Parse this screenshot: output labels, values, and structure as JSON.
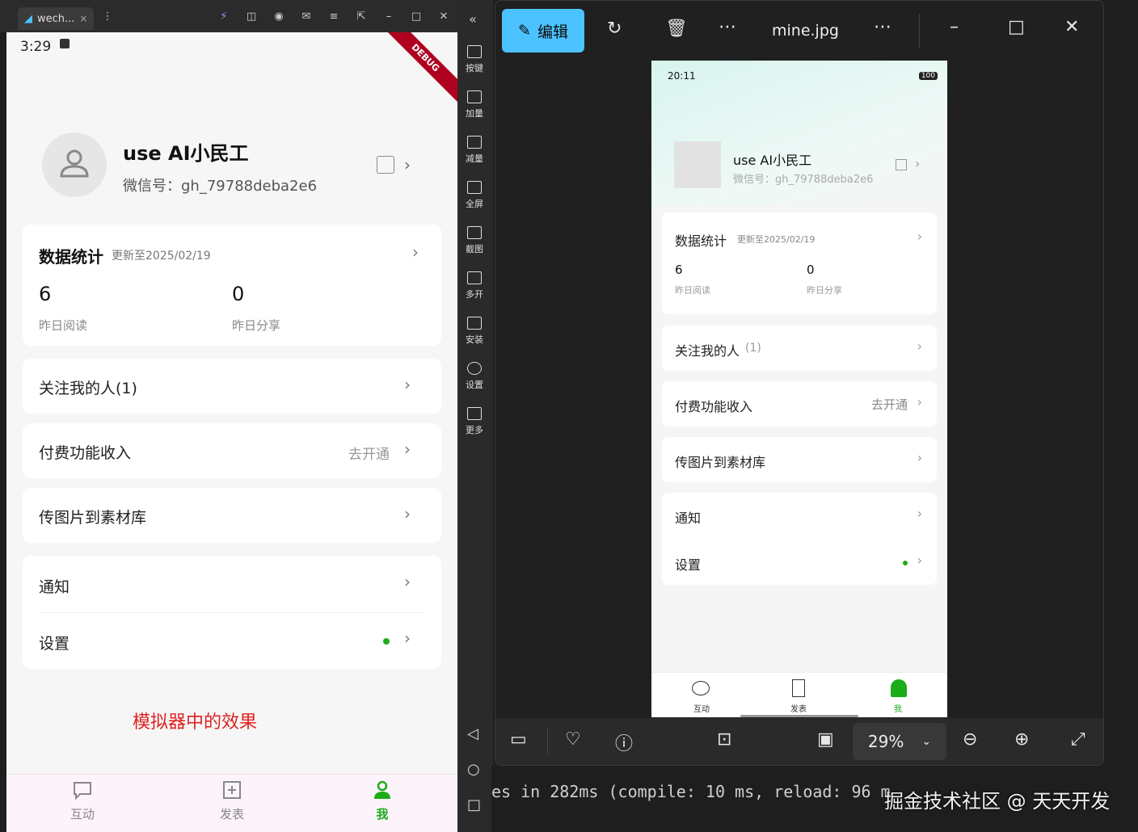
{
  "emulator": {
    "tab_label": "wech...",
    "tab_close": "×",
    "status_time": "3:29",
    "debug_ribbon": "DEBUG",
    "profile": {
      "nickname": "use AI小民工",
      "wechat_id": "微信号：gh_79788deba2e6"
    },
    "stats": {
      "title": "数据统计",
      "updated": "更新至2025/02/19",
      "read_value": "6",
      "read_label": "昨日阅读",
      "share_value": "0",
      "share_label": "昨日分享"
    },
    "rows": {
      "followers": "关注我的人(1)",
      "paid": "付费功能收入",
      "paid_action": "去开通",
      "upload": "传图片到素材库",
      "notify": "通知",
      "settings": "设置"
    },
    "caption": "模拟器中的效果",
    "tabs": {
      "interact": "互动",
      "publish": "发表",
      "me": "我"
    }
  },
  "side_toolbar": {
    "items": [
      "按键",
      "加量",
      "减量",
      "全屏",
      "截图",
      "多开",
      "安装",
      "设置",
      "更多"
    ]
  },
  "viewer": {
    "edit_label": "编辑",
    "filename": "mine.jpg",
    "zoom": "29%",
    "image": {
      "status_time": "20:11",
      "battery": "100",
      "nickname": "use AI小民工",
      "wechat_id": "微信号：gh_79788deba2e6",
      "stats_title": "数据统计",
      "stats_updated": "更新至2025/02/19",
      "read_value": "6",
      "read_label": "昨日阅读",
      "share_value": "0",
      "share_label": "昨日分享",
      "followers": "关注我的人",
      "followers_count": "(1)",
      "paid": "付费功能收入",
      "paid_action": "去开通",
      "upload": "传图片到素材库",
      "notify": "通知",
      "settings": "设置",
      "tab_interact": "互动",
      "tab_publish": "发表",
      "tab_me": "我"
    }
  },
  "terminal": {
    "line": "es in 282ms (compile: 10 ms, reload: 96 m"
  },
  "watermark": "掘金技术社区 @ 天天开发",
  "colors": {
    "accent_green": "#1aad19",
    "edit_blue": "#4cc2ff",
    "caption_red": "#e02020"
  }
}
